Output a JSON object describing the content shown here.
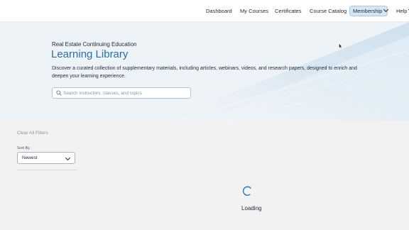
{
  "nav": {
    "items": [
      {
        "label": "Dashboard"
      },
      {
        "label": "My Courses"
      },
      {
        "label": "Certificates"
      },
      {
        "label": "Course Catalog"
      }
    ],
    "membership_label": "Membership",
    "help_label": "Help"
  },
  "hero": {
    "eyebrow": "Real Estate Continuing Education",
    "title": "Learning Library",
    "description": "Discover a curated collection of supplementary materials, including articles, webinars, videos, and research papers, designed to enrich and deepen your learning experience.",
    "search_placeholder": "Search instructors, classes, and topics",
    "search_value": ""
  },
  "filters": {
    "clear_label": "Clear All Filters",
    "sort_label": "Sort By",
    "sort_value": "Newest"
  },
  "status": {
    "loading_label": "Loading"
  },
  "colors": {
    "accent": "#2a6fa8",
    "membership_bg": "#d6e6f3",
    "hero_bg": "#eef3f7",
    "page_bg": "#f2f2f2"
  },
  "icons": {
    "search": "search-icon",
    "dropdown": "chevron-down-icon",
    "spinner": "spinner-icon",
    "cursor": "cursor-icon"
  }
}
